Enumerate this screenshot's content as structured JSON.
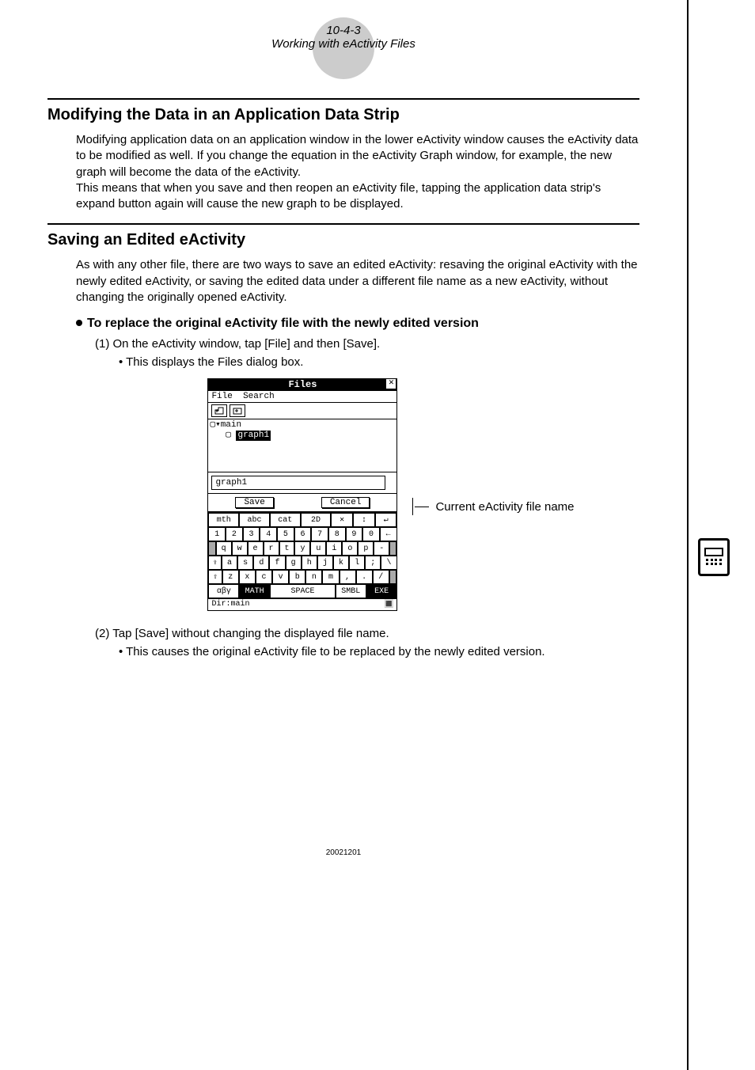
{
  "header": {
    "page_number": "10-4-3",
    "title": "Working with eActivity Files"
  },
  "section1": {
    "heading": "Modifying the Data in an Application Data Strip",
    "para": "Modifying application data on an application window in the lower eActivity window causes the eActivity data to be modified as well. If you change the equation in the eActivity Graph window, for example, the new graph will become the data of the eActivity.\nThis means that when you save and then reopen an eActivity file, tapping the application data strip's expand button again will cause the new graph to be displayed."
  },
  "section2": {
    "heading": "Saving an Edited eActivity",
    "para": "As with any other file, there are two ways to save an edited eActivity: resaving the original eActivity with the newly edited eActivity, or saving the edited data under a different file name as a new eActivity, without changing the originally opened eActivity.",
    "sub_heading": "To replace the original eActivity file with the newly edited version",
    "step1": "(1) On the eActivity window, tap [File] and then [Save].",
    "step1_sub": "• This displays the Files dialog box.",
    "step2": "(2) Tap [Save] without changing the displayed file name.",
    "step2_sub": "• This causes the original eActivity file to be replaced by the newly edited version."
  },
  "dialog": {
    "title": "Files",
    "menu": {
      "file": "File",
      "search": "Search"
    },
    "tree": {
      "root": "main",
      "child": "graph1"
    },
    "filename": "graph1",
    "save_btn": "Save",
    "cancel_btn": "Cancel",
    "status_left": "Dir:main"
  },
  "keyboard": {
    "row1": [
      "mth",
      "abc",
      "cat",
      "2D",
      "✕",
      "↕",
      "↵"
    ],
    "row2": [
      "1",
      "2",
      "3",
      "4",
      "5",
      "6",
      "7",
      "8",
      "9",
      "0",
      "←"
    ],
    "row3": [
      "q",
      "w",
      "e",
      "r",
      "t",
      "y",
      "u",
      "i",
      "o",
      "p",
      "-"
    ],
    "row4": [
      "a",
      "s",
      "d",
      "f",
      "g",
      "h",
      "j",
      "k",
      "l",
      ";",
      "\\"
    ],
    "row5": [
      "⇧",
      "z",
      "x",
      "c",
      "v",
      "b",
      "n",
      "m",
      ",",
      ".",
      "/"
    ],
    "row6": [
      "αβγ",
      "MATH",
      "SPACE",
      "SMBL",
      "EXE"
    ]
  },
  "annotation": "Current eActivity file name",
  "footer": "20021201"
}
